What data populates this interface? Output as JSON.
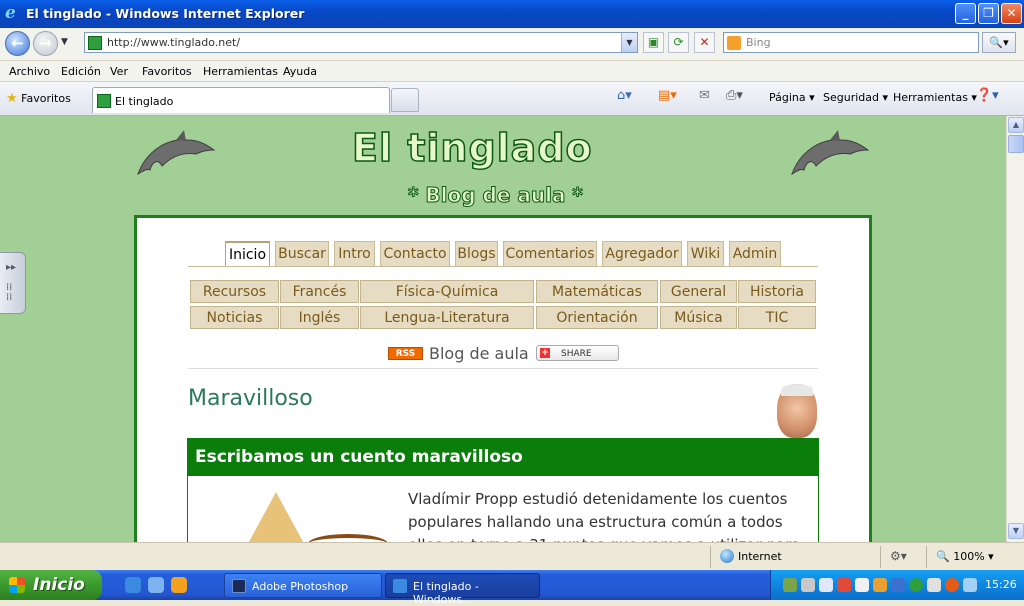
{
  "window": {
    "title": "El tinglado - Windows Internet Explorer"
  },
  "address": {
    "url": "http://www.tinglado.net/",
    "search_placeholder": "Bing"
  },
  "menu": [
    "Archivo",
    "Edición",
    "Ver",
    "Favoritos",
    "Herramientas",
    "Ayuda"
  ],
  "favorites_label": "Favoritos",
  "tab": {
    "label": "El tinglado"
  },
  "commands": {
    "page": "Página ▾",
    "security": "Seguridad ▾",
    "tools": "Herramientas ▾"
  },
  "site": {
    "title": "El tinglado",
    "subtitle": "* Blog de aula *",
    "nav_tabs": [
      "Inicio",
      "Buscar",
      "Intro",
      "Contacto",
      "Blogs",
      "Comentarios",
      "Agregador",
      "Wiki",
      "Admin"
    ],
    "categories_row1": [
      "Recursos",
      "Francés",
      "Física-Química",
      "Matemáticas",
      "General",
      "Historia"
    ],
    "categories_row2": [
      "Noticias",
      "Inglés",
      "Lengua-Literatura",
      "Orientación",
      "Música",
      "TIC"
    ],
    "rss_label": "RSS",
    "blog_label": "Blog de aula",
    "share_label": "SHARE",
    "post_section_title": "Maravilloso",
    "post_title": "Escribamos un cuento maravilloso",
    "post_text": "Vladímir Propp estudió detenidamente los cuentos populares hallando una estructura común a todos ellos en torno a 31 puntos que vamos a utilizar para escribir"
  },
  "status": {
    "zone": "Internet",
    "zoom": "100%"
  },
  "taskbar": {
    "start_label": "Inicio",
    "tasks": [
      "Adobe Photoshop",
      "El tinglado - Windows..."
    ],
    "clock": "15:26"
  }
}
